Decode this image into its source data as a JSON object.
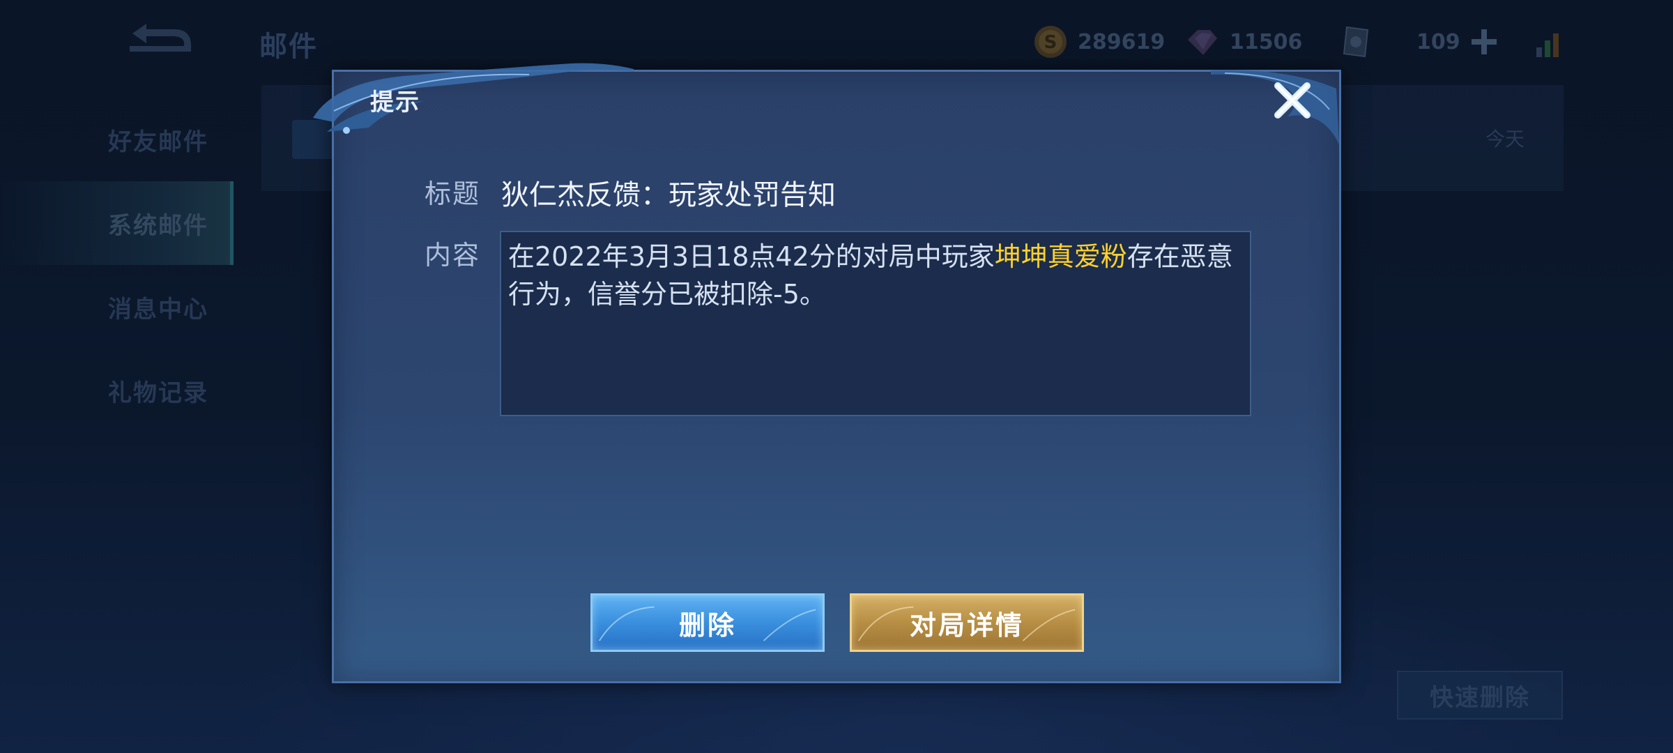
{
  "header": {
    "title": "邮件",
    "currencies": {
      "gold": "289619",
      "gems": "11506",
      "cards": "109"
    }
  },
  "sidebar": {
    "items": [
      {
        "label": "好友邮件"
      },
      {
        "label": "系统邮件",
        "active": true
      },
      {
        "label": "消息中心"
      },
      {
        "label": "礼物记录"
      }
    ]
  },
  "mail_list": {
    "row_date": "今天"
  },
  "footer": {
    "quick_delete_label": "快速删除"
  },
  "dialog": {
    "title": "提示",
    "subject_label": "标题",
    "subject_value": "狄仁杰反馈：玩家处罚告知",
    "content_label": "内容",
    "content_part1": "在2022年3月3日18点42分的对局中玩家",
    "content_highlight": "坤坤真爱粉",
    "content_part2": "存在恶意行为，信誉分已被扣除-5。",
    "delete_label": "删除",
    "detail_label": "对局详情"
  },
  "colors": {
    "highlight": "#ffd12b",
    "delete_button": "#3a8fde",
    "detail_button": "#b78e44"
  }
}
